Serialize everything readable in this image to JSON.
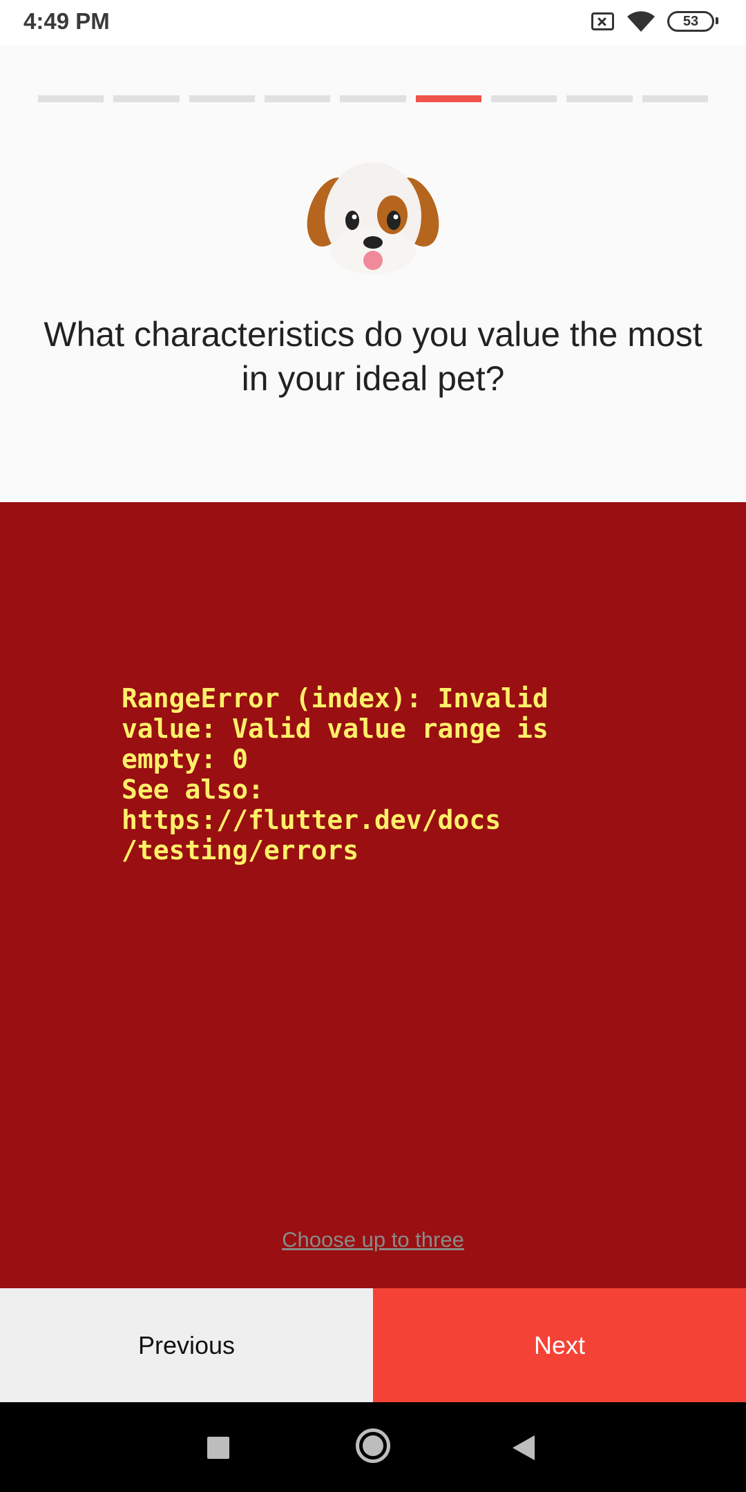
{
  "status_bar": {
    "time": "4:49 PM",
    "battery": "53",
    "icons": [
      "sim-off-icon",
      "wifi-icon",
      "battery-icon"
    ]
  },
  "progress": {
    "total_steps": 9,
    "current_step": 6,
    "active_color": "#f0544b"
  },
  "question": {
    "emoji_icon": "dog-face-icon",
    "text": "What characteristics do you value the most in your ideal pet?"
  },
  "error": {
    "background_color": "#9a0f11",
    "text_color": "#fff06a",
    "message": "RangeError (index): Invalid\nvalue: Valid value range is\nempty: 0\nSee also:\nhttps://flutter.dev/docs\n/testing/errors"
  },
  "hint": {
    "text": "Choose up to three"
  },
  "buttons": {
    "previous_label": "Previous",
    "next_label": "Next",
    "next_color": "#f44336"
  },
  "nav_bar": {
    "icons": [
      "recents-icon",
      "home-icon",
      "back-icon"
    ]
  }
}
